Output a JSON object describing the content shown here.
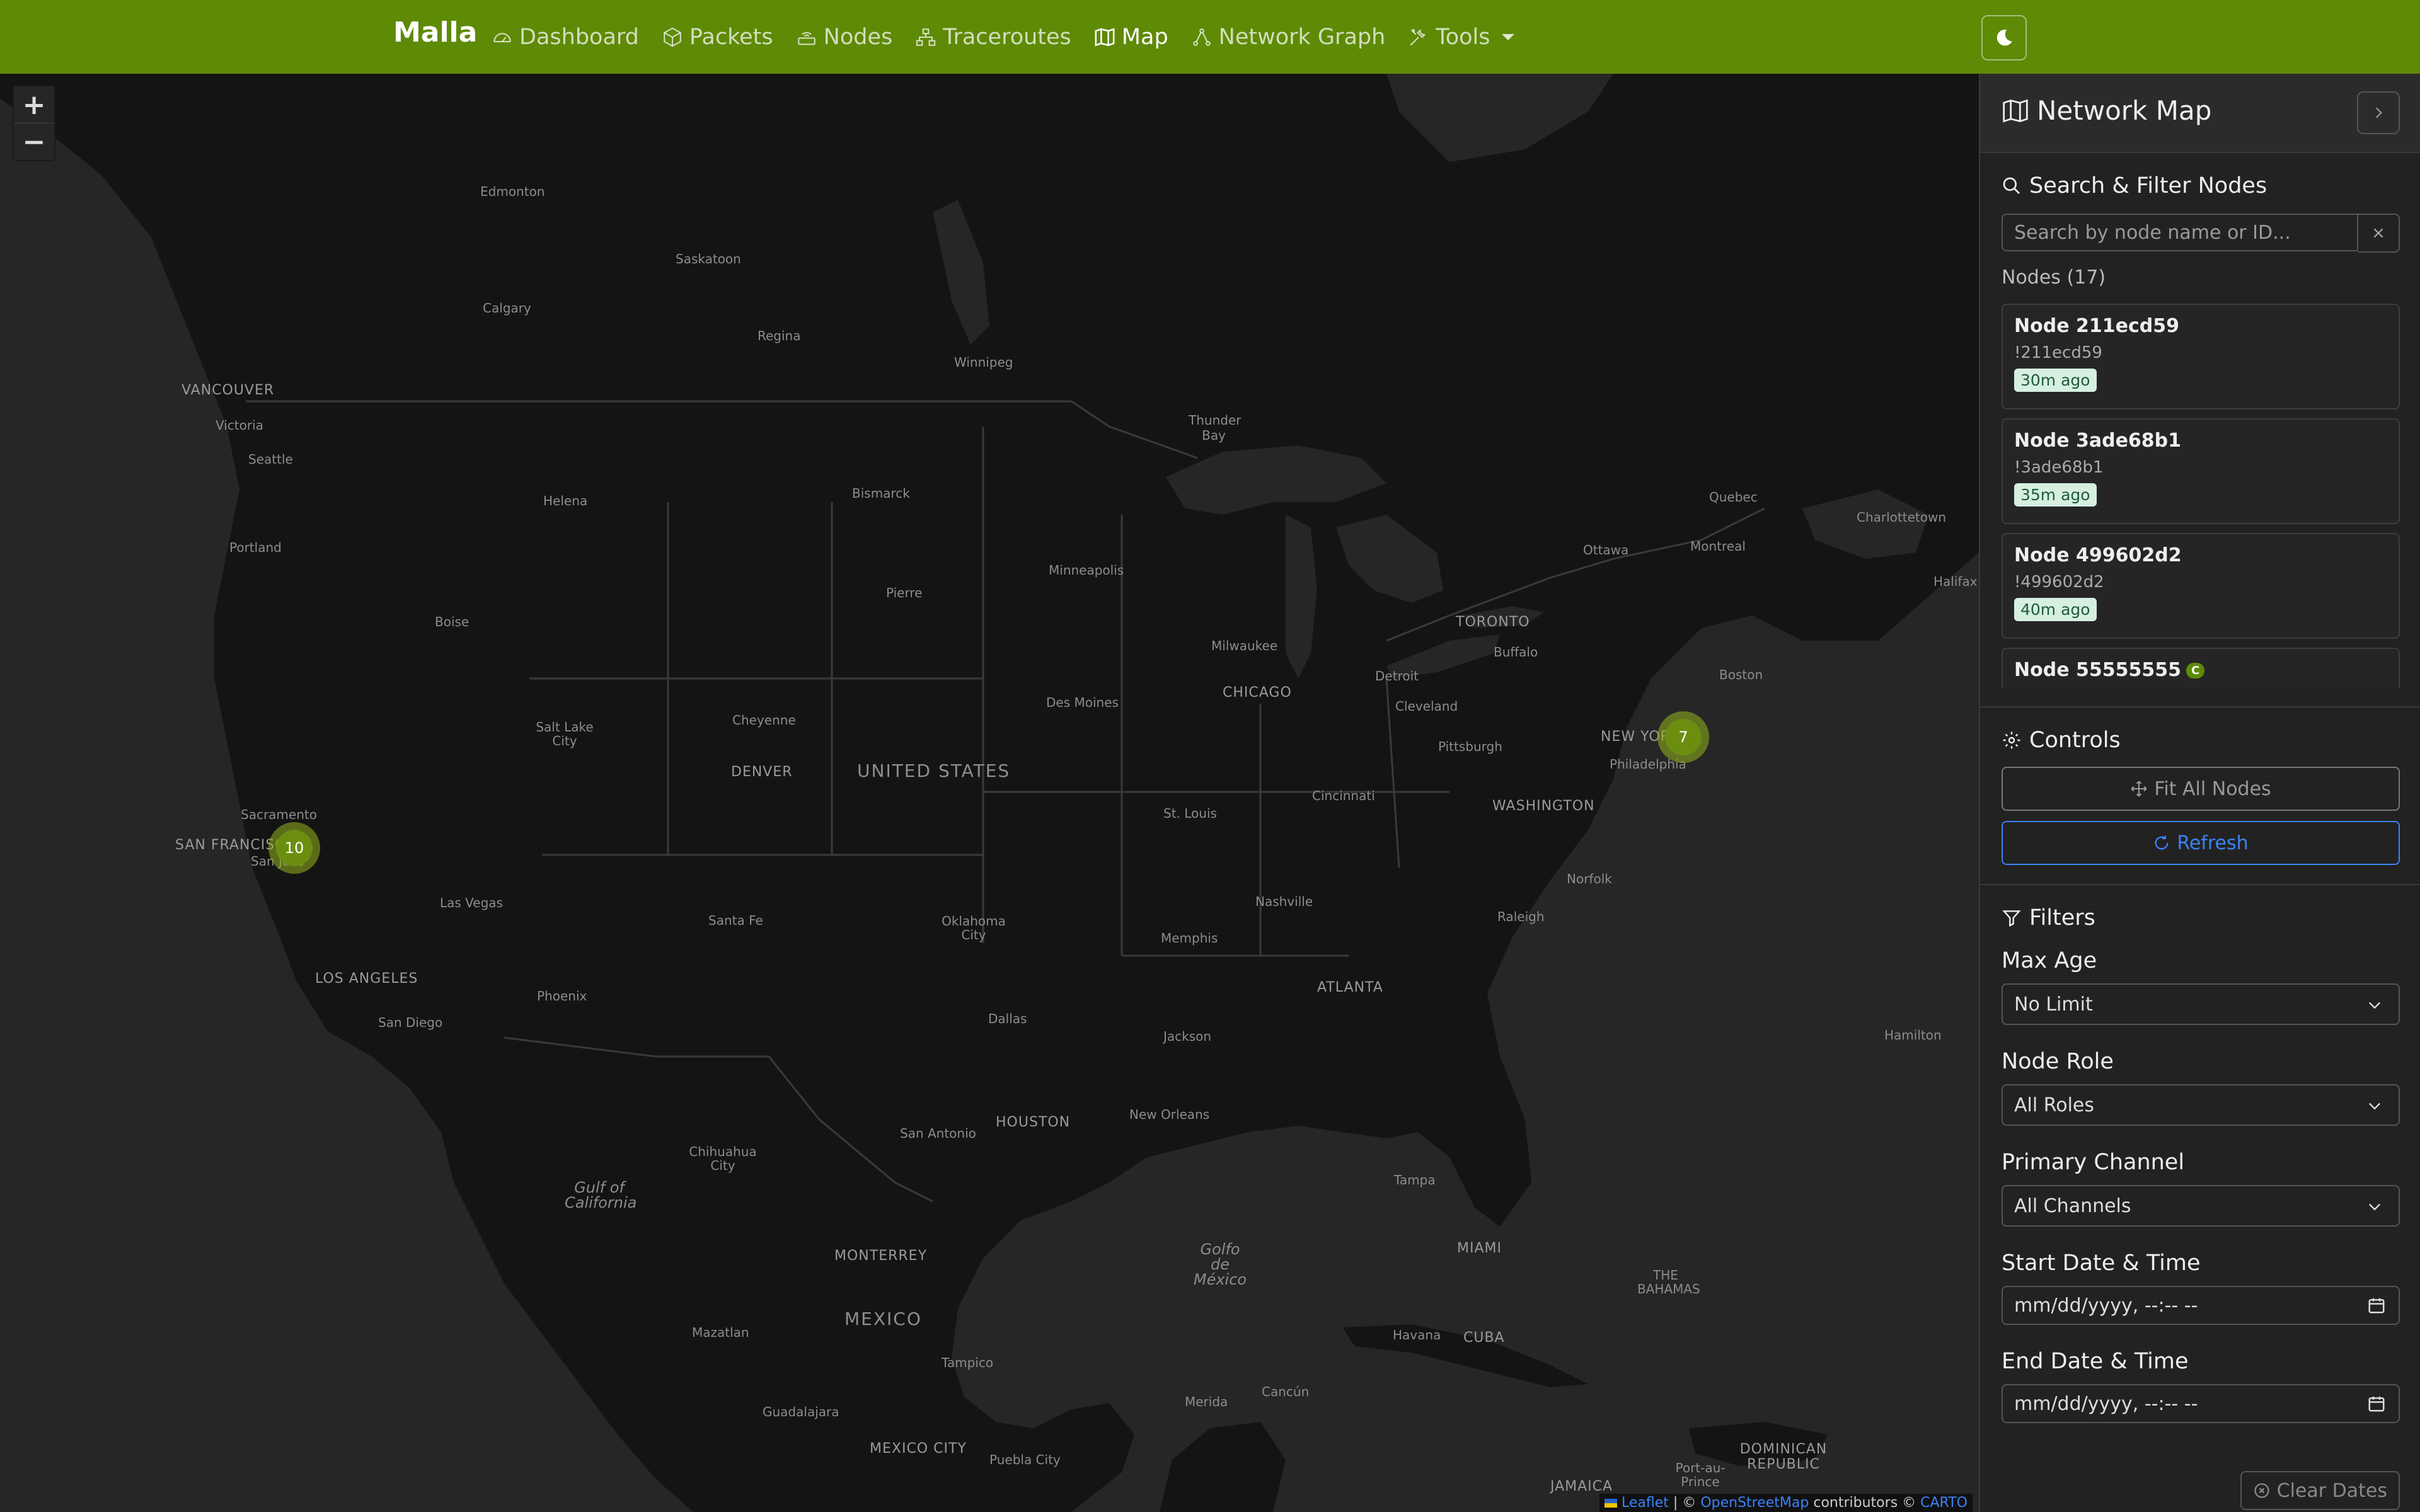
{
  "navbar": {
    "brand": "Malla",
    "items": [
      {
        "label": "Dashboard",
        "icon": "speedometer-icon"
      },
      {
        "label": "Packets",
        "icon": "box-icon"
      },
      {
        "label": "Nodes",
        "icon": "router-icon"
      },
      {
        "label": "Traceroutes",
        "icon": "diagram-icon"
      },
      {
        "label": "Map",
        "icon": "map-icon",
        "active": true
      },
      {
        "label": "Network Graph",
        "icon": "graph-icon"
      },
      {
        "label": "Tools",
        "icon": "tools-icon",
        "dropdown": true
      }
    ],
    "theme_toggle_icon": "moon-icon",
    "color": "#5e8a06"
  },
  "map": {
    "zoom_in": "+",
    "zoom_out": "−",
    "clusters": [
      {
        "count": "10"
      },
      {
        "count": "7"
      }
    ],
    "labels": {
      "edmonton": "Edmonton",
      "saskatoon": "Saskatoon",
      "calgary": "Calgary",
      "regina": "Regina",
      "winnipeg": "Winnipeg",
      "vancouver": "VANCOUVER",
      "victoria": "Victoria",
      "seattle": "Seattle",
      "thunder_bay": "Thunder Bay",
      "helena": "Helena",
      "bismarck": "Bismarck",
      "portland": "Portland",
      "minneapolis": "Minneapolis",
      "pierre": "Pierre",
      "boise": "Boise",
      "milwaukee": "Milwaukee",
      "toronto": "TORONTO",
      "ottawa": "Ottawa",
      "montreal": "Montreal",
      "quebec": "Quebec",
      "charlottetown": "Charlottetown",
      "halifax": "Halifax",
      "buffalo": "Buffalo",
      "detroit": "Detroit",
      "boston": "Boston",
      "chicago": "CHICAGO",
      "des_moines": "Des Moines",
      "cleveland": "Cleveland",
      "salt_lake_city": "Salt Lake City",
      "cheyenne": "Cheyenne",
      "new_york": "NEW YORK",
      "pittsburgh": "Pittsburgh",
      "philadelphia": "Philadelphia",
      "denver": "DENVER",
      "united_states": "UNITED STATES",
      "washington": "WASHINGTON",
      "cincinnati": "Cincinnati",
      "st_louis": "St. Louis",
      "sacramento": "Sacramento",
      "san_francisco": "SAN FRANCISCO",
      "san_jose": "San Jose",
      "norfolk": "Norfolk",
      "las_vegas": "Las Vegas",
      "nashville": "Nashville",
      "raleigh": "Raleigh",
      "santa_fe": "Santa Fe",
      "oklahoma_city": "Oklahoma City",
      "memphis": "Memphis",
      "los_angeles": "LOS ANGELES",
      "atlanta": "ATLANTA",
      "phoenix": "Phoenix",
      "san_diego": "San Diego",
      "dallas": "Dallas",
      "hamilton": "Hamilton",
      "jackson": "Jackson",
      "new_orleans": "New Orleans",
      "houston": "HOUSTON",
      "san_antonio": "San Antonio",
      "chihuahua_city": "Chihuahua City",
      "tampa": "Tampa",
      "gulf_of_california": "Gulf of California",
      "gulf_of_mexico": "Golfo de México",
      "miami": "MIAMI",
      "the_bahamas": "THE BAHAMAS",
      "monterrey": "MONTERREY",
      "mexico": "MEXICO",
      "havana": "Havana",
      "cuba": "CUBA",
      "mazatlan": "Mazatlan",
      "tampico": "Tampico",
      "guadalajara": "Guadalajara",
      "merida": "Merida",
      "cancun": "Cancún",
      "mexico_city": "MEXICO CITY",
      "puebla_city": "Puebla City",
      "jamaica": "JAMAICA",
      "port_au_prince": "Port-au-Prince",
      "dominican_republic": "DOMINICAN REPUBLIC"
    },
    "attribution": {
      "leaflet": "Leaflet",
      "sep": " | © ",
      "osm": "OpenStreetMap",
      "contributors": " contributors © ",
      "carto": "CARTO"
    }
  },
  "sidebar": {
    "title": "Network Map",
    "search": {
      "title": "Search & Filter Nodes",
      "placeholder": "Search by node name or ID...",
      "clear": "×",
      "nodes_count": "Nodes (17)"
    },
    "nodes": [
      {
        "name": "Node 211ecd59",
        "id": "!211ecd59",
        "age": "30m ago"
      },
      {
        "name": "Node 3ade68b1",
        "id": "!3ade68b1",
        "age": "35m ago"
      },
      {
        "name": "Node 499602d2",
        "id": "!499602d2",
        "age": "40m ago"
      },
      {
        "name": "Node 55555555",
        "id": "",
        "age": "",
        "role_badge": "C"
      }
    ],
    "controls": {
      "title": "Controls",
      "fit_all": "Fit All Nodes",
      "refresh": "Refresh"
    },
    "filters": {
      "title": "Filters",
      "max_age_label": "Max Age",
      "max_age_value": "No Limit",
      "role_label": "Node Role",
      "role_value": "All Roles",
      "channel_label": "Primary Channel",
      "channel_value": "All Channels",
      "start_label": "Start Date & Time",
      "start_value": "mm/dd/yyyy, --:-- --",
      "end_label": "End Date & Time",
      "end_value": "mm/dd/yyyy, --:-- --",
      "clear_dates": "Clear Dates"
    }
  }
}
